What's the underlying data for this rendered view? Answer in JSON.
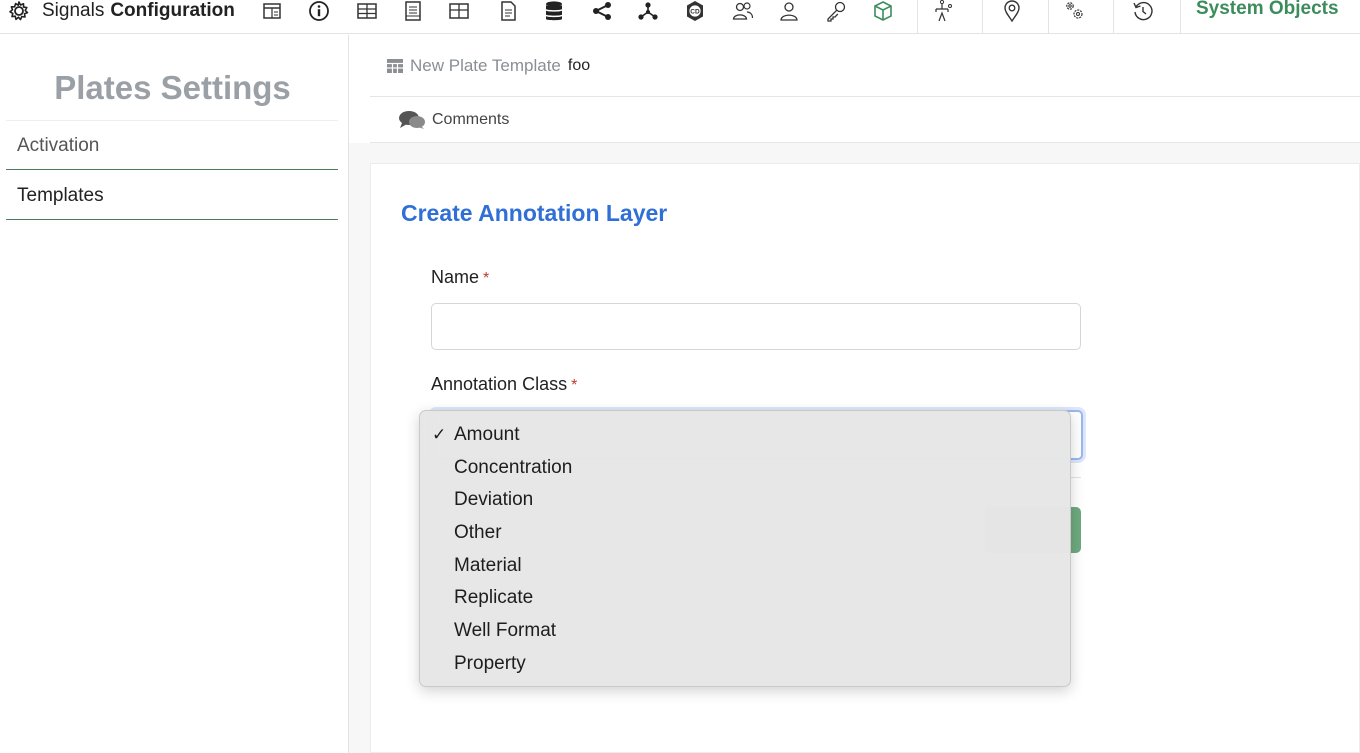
{
  "app": {
    "brand_prefix": "Signals",
    "brand_name": "Configuration",
    "system_objects_label": "System Objects"
  },
  "toolbar_icons": [
    "layout-icon",
    "info-icon",
    "table-icon",
    "document-list-icon",
    "grid-icon",
    "file-text-icon",
    "database-icon",
    "share-icon",
    "network-icon",
    "cd-badge-icon",
    "users-icon",
    "user-icon",
    "key-icon",
    "cube-icon",
    "hierarchy-icon",
    "location-pin-icon",
    "settings-gears-icon",
    "history-icon"
  ],
  "sidebar": {
    "title": "Plates Settings",
    "items": [
      {
        "label": "Activation"
      },
      {
        "label": "Templates"
      }
    ]
  },
  "breadcrumb": {
    "section": "New Plate Template",
    "name": "foo"
  },
  "comments": {
    "label": "Comments"
  },
  "form": {
    "title": "Create Annotation Layer",
    "name_label": "Name",
    "name_value": "",
    "class_label": "Annotation Class",
    "required_mark": "*",
    "class_selected": "Amount"
  },
  "dropdown": {
    "check_mark": "✓",
    "options": [
      "Amount",
      "Concentration",
      "Deviation",
      "Other",
      "Material",
      "Replicate",
      "Well Format",
      "Property"
    ]
  },
  "colors": {
    "accent_green": "#3d8c5c",
    "title_blue": "#2f6fd6",
    "required_red": "#c0392b",
    "sidebar_underline": "#4a7a5c"
  }
}
